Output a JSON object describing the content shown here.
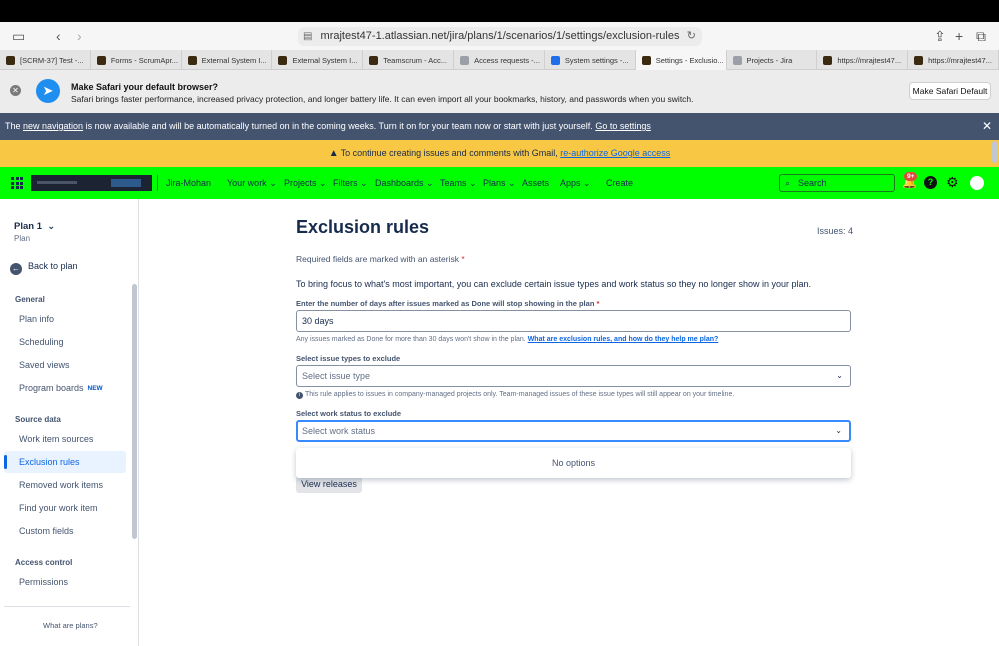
{
  "browser": {
    "url": "mrajtest47-1.atlassian.net/jira/plans/1/scenarios/1/settings/exclusion-rules",
    "tabs": [
      {
        "label": "[SCRM-37] Test -...",
        "icon": "jira-favicon"
      },
      {
        "label": "Forms - ScrumApr...",
        "icon": "jira-favicon"
      },
      {
        "label": "External System I...",
        "icon": "jira-favicon"
      },
      {
        "label": "External System I...",
        "icon": "jira-favicon"
      },
      {
        "label": "Teamscrum - Acc...",
        "icon": "jira-favicon"
      },
      {
        "label": "Access requests -...",
        "icon": "atlassian-favicon"
      },
      {
        "label": "System settings -...",
        "icon": "settings-favicon"
      },
      {
        "label": "Settings - Exclusio...",
        "icon": "jira-favicon"
      },
      {
        "label": "Projects - Jira",
        "icon": "atlassian-favicon"
      },
      {
        "label": "https://mrajtest47...",
        "icon": "jira-favicon"
      },
      {
        "label": "https://mrajtest47...",
        "icon": "jira-favicon"
      }
    ]
  },
  "safari_banner": {
    "title": "Make Safari your default browser?",
    "text": "Safari brings faster performance, increased privacy protection, and longer battery life. It can even import all your bookmarks, history, and passwords when you switch.",
    "button": "Make Safari Default"
  },
  "nav_banner": {
    "prefix": "The ",
    "link": "new navigation",
    "middle": " is now available and will be automatically turned on in the coming weeks. Turn it on for your team now or start with just yourself. ",
    "link2": "Go to settings"
  },
  "warn_banner": {
    "text": "To continue creating issues and comments with Gmail, ",
    "link": "re-authorize Google access"
  },
  "header": {
    "site": "Jira-Mohan",
    "nav": [
      "Your work",
      "Projects",
      "Filters",
      "Dashboards",
      "Teams",
      "Plans",
      "Assets",
      "Apps"
    ],
    "create": "Create",
    "search_placeholder": "Search",
    "notifications_badge": "9+",
    "accent": "#00ff00"
  },
  "sidebar": {
    "plan_title": "Plan 1",
    "plan_sub": "Plan",
    "back": "Back to plan",
    "general": "General",
    "general_items": [
      "Plan info",
      "Scheduling",
      "Saved views",
      "Program boards"
    ],
    "new_badge": "NEW",
    "source": "Source data",
    "source_items": [
      "Work item sources",
      "Exclusion rules",
      "Removed work items",
      "Find your work item",
      "Custom fields"
    ],
    "access": "Access control",
    "access_items": [
      "Permissions"
    ],
    "footer": "What are plans?"
  },
  "main": {
    "title": "Exclusion rules",
    "issues": "Issues: 4",
    "required_note": "Required fields are marked with an asterisk",
    "intro": "To bring focus to what's most important, you can exclude certain issue types and work status so they no longer show in your plan.",
    "days_label": "Enter the number of days after issues marked as Done will stop showing in the plan",
    "days_value": "30 days",
    "days_help": "Any issues marked as Done for more than 30 days won't show in the plan. ",
    "days_help_link": "What are exclusion rules, and how do they help me plan?",
    "types_label": "Select issue types to exclude",
    "types_placeholder": "Select issue type",
    "types_help": "This rule applies to issues in company-managed projects only. Team-managed issues of these issue types will still appear on your timeline.",
    "status_label": "Select work status to exclude",
    "status_placeholder": "Select work status",
    "no_options": "No options",
    "view_releases": "View releases"
  }
}
